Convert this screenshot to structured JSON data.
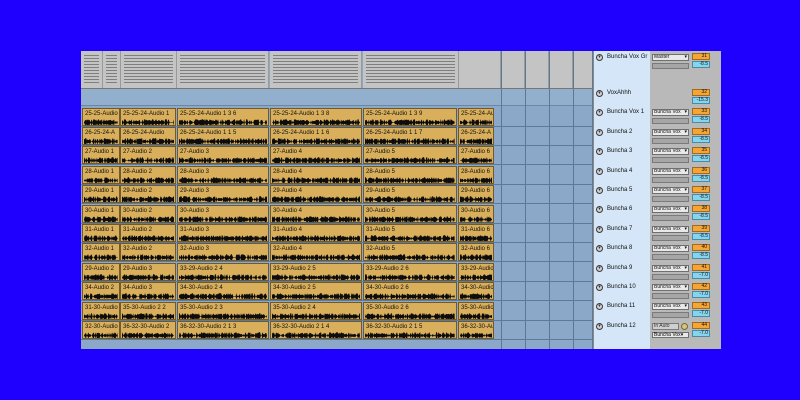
{
  "colors": {
    "background": "#1f00ff",
    "clip": "#d9af5b",
    "track_number": "#f6a534",
    "volume": "#86d5ef",
    "selected_column": "#d4e6f7"
  },
  "arrangement": {
    "rows": [
      {
        "clips": [
          "25-25-Audio 1",
          "25-25-24-Audio 1",
          "25-25-24-Audio 1 3 6",
          "25-25-24-Audio 1 3 8",
          "25-25-24-Audio 1 3 9",
          "25-25-24-Au"
        ]
      },
      {
        "clips": [
          "26-25-24-A",
          "26-25-24-Audio",
          "26-25-24-Audio 1 1 5",
          "26-25-24-Audio 1 1 6",
          "26-25-24-Audio 1 1 7",
          "26-25-24-A"
        ]
      },
      {
        "clips": [
          "27-Audio 1",
          "27-Audio 2",
          "27-Audio 3",
          "27-Audio 4",
          "27-Audio 5",
          "27-Audio 6"
        ]
      },
      {
        "clips": [
          "28-Audio 1",
          "28-Audio 2",
          "28-Audio 3",
          "28-Audio 4",
          "28-Audio 5",
          "28-Audio 6"
        ]
      },
      {
        "clips": [
          "29-Audio 1",
          "29-Audio 2",
          "29-Audio 3",
          "29-Audio 4",
          "29-Audio 5",
          "29-Audio 6"
        ]
      },
      {
        "clips": [
          "30-Audio 1",
          "30-Audio 2",
          "30-Audio 3",
          "30-Audio 4",
          "30-Audio 5",
          "30-Audio 6"
        ]
      },
      {
        "clips": [
          "31-Audio 1",
          "31-Audio 2",
          "31-Audio 3",
          "31-Audio 4",
          "31-Audio 5",
          "31-Audio 6"
        ]
      },
      {
        "clips": [
          "32-Audio 1",
          "32-Audio 2",
          "32-Audio 3",
          "32-Audio 4",
          "32-Audio 5",
          "32-Audio 6"
        ]
      },
      {
        "clips": [
          "29-Audio 2",
          "29-Audio 3",
          "33-29-Audio 2 4",
          "33-29-Audio 2 5",
          "33-29-Audio 2 6",
          "33-29-Audio"
        ]
      },
      {
        "clips": [
          "34-Audio 2",
          "34-Audio 3",
          "34-30-Audio 2 4",
          "34-30-Audio 2 5",
          "34-30-Audio 2 6",
          "34-30-Audio"
        ]
      },
      {
        "clips": [
          "31-30-Audio",
          "35-30-Audio 2 2",
          "35-30-Audio 2 3",
          "35-30-Audio 2 4",
          "35-30-Audio 2 6",
          "35-30-Audio"
        ]
      },
      {
        "clips": [
          "32-30-Audio",
          "36-32-30-Audio 2",
          "36-32-30-Audio 2 1 3",
          "36-32-30-Audio 2 1 4",
          "36-32-30-Audio 2 1 5",
          "36-32-30-Audio"
        ]
      }
    ]
  },
  "mixer": {
    "group": {
      "name": "Buncha Vox Gr",
      "output": "Master",
      "number": "31",
      "volume": "-8.5"
    },
    "tracks": [
      {
        "name": "VoxAhhh",
        "output": "",
        "number": "32",
        "volume": "-15.3"
      },
      {
        "name": "Buncha Vox 1",
        "output": "Buncha Vox",
        "number": "33",
        "volume": "-8.5"
      },
      {
        "name": "Buncha 2",
        "output": "Buncha Vox",
        "number": "34",
        "volume": "-8.5"
      },
      {
        "name": "Buncha 3",
        "output": "Buncha Vox",
        "number": "35",
        "volume": "-8.5"
      },
      {
        "name": "Buncha 4",
        "output": "Buncha Vox",
        "number": "36",
        "volume": "-8.5"
      },
      {
        "name": "Buncha 5",
        "output": "Buncha Vox",
        "number": "37",
        "volume": "-8.5"
      },
      {
        "name": "Buncha 6",
        "output": "Buncha Vox",
        "number": "38",
        "volume": "-8.5"
      },
      {
        "name": "Buncha 7",
        "output": "Buncha Vox",
        "number": "39",
        "volume": "-8.5"
      },
      {
        "name": "Buncha 8",
        "output": "Buncha Vox",
        "number": "40",
        "volume": "-8.5"
      },
      {
        "name": "Buncha 9",
        "output": "Buncha Vox",
        "number": "41",
        "volume": "-7.0"
      },
      {
        "name": "Buncha 10",
        "output": "Buncha Vox",
        "number": "42",
        "volume": "-7.0"
      },
      {
        "name": "Buncha 11",
        "output": "Buncha Vox",
        "number": "43",
        "volume": "-7.0"
      },
      {
        "name": "Buncha 12",
        "output": "Buncha Vox",
        "number": "44",
        "volume": "-7.0",
        "input_label": "In Auto"
      }
    ]
  }
}
